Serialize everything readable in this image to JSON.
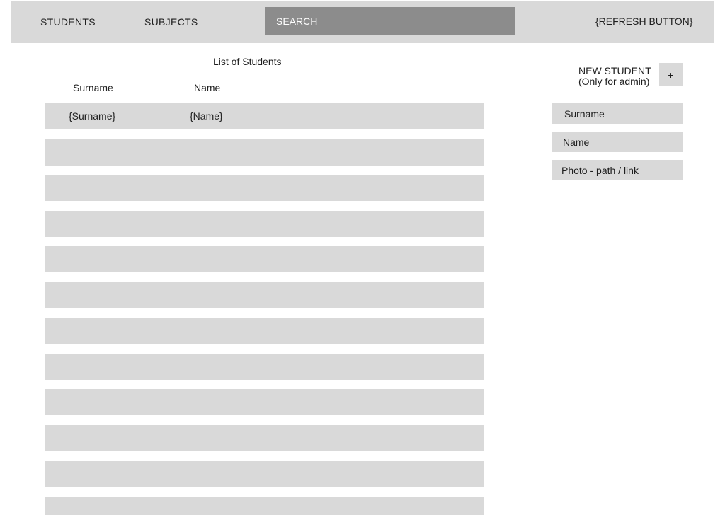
{
  "header": {
    "nav_students": "STUDENTS",
    "nav_subjects": "SUBJECTS",
    "search_placeholder": "SEARCH",
    "refresh_label": "{REFRESH BUTTON}"
  },
  "list": {
    "title": "List of Students",
    "columns": {
      "surname": "Surname",
      "name": "Name"
    },
    "rows": [
      {
        "surname": "{Surname}",
        "name": "{Name}"
      },
      {
        "surname": "",
        "name": ""
      },
      {
        "surname": "",
        "name": ""
      },
      {
        "surname": "",
        "name": ""
      },
      {
        "surname": "",
        "name": ""
      },
      {
        "surname": "",
        "name": ""
      },
      {
        "surname": "",
        "name": ""
      },
      {
        "surname": "",
        "name": ""
      },
      {
        "surname": "",
        "name": ""
      },
      {
        "surname": "",
        "name": ""
      },
      {
        "surname": "",
        "name": ""
      },
      {
        "surname": "",
        "name": ""
      }
    ]
  },
  "new_student": {
    "label_line1": "NEW STUDENT",
    "label_line2": "(Only for admin)",
    "add_label": "+",
    "surname_placeholder": "Surname",
    "name_placeholder": "Name",
    "photo_placeholder": "Photo - path / link"
  },
  "colors": {
    "bar": "#d9d9d9",
    "search_bg": "#8c8c8c",
    "text": "#1e1e1e"
  }
}
